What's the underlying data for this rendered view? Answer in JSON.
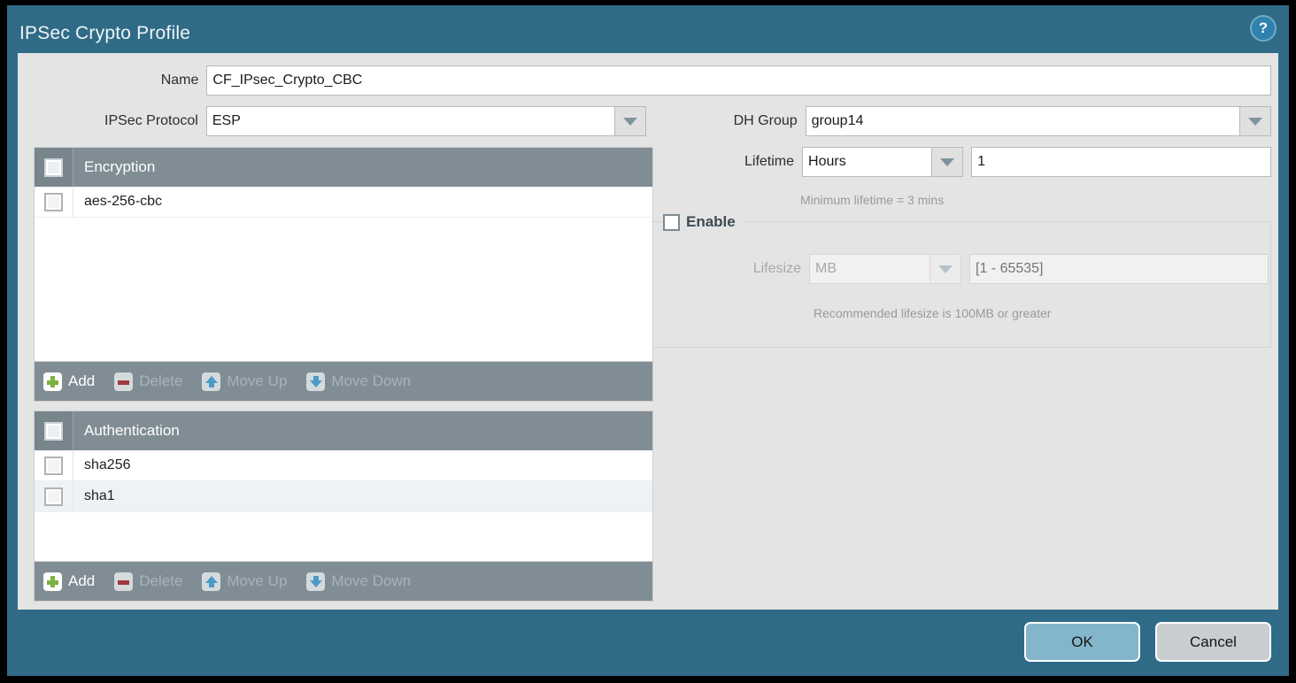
{
  "window": {
    "title": "IPSec Crypto Profile",
    "help_icon": "help-circle-icon",
    "help_glyph": "?"
  },
  "form": {
    "name": {
      "label": "Name",
      "value": "CF_IPsec_Crypto_CBC"
    },
    "ipsec_protocol": {
      "label": "IPSec Protocol",
      "value": "ESP"
    },
    "dh_group": {
      "label": "DH Group",
      "value": "group14"
    },
    "lifetime": {
      "label": "Lifetime",
      "unit": "Hours",
      "value": "1",
      "hint": "Minimum lifetime = 3 mins"
    },
    "lifesize": {
      "enable_label": "Enable",
      "label": "Lifesize",
      "unit": "MB",
      "value": "",
      "placeholder": "[1 - 65535]",
      "hint": "Recommended lifesize is 100MB or greater"
    }
  },
  "encryption_panel": {
    "header": "Encryption",
    "rows": [
      {
        "label": "aes-256-cbc"
      }
    ]
  },
  "authentication_panel": {
    "header": "Authentication",
    "rows": [
      {
        "label": "sha256"
      },
      {
        "label": "sha1"
      }
    ]
  },
  "toolbar": {
    "add": "Add",
    "delete": "Delete",
    "move_up": "Move Up",
    "move_down": "Move Down"
  },
  "footer": {
    "ok": "OK",
    "cancel": "Cancel"
  },
  "colors": {
    "title_bar": "#2f6b87",
    "body": "#e4e4e4",
    "list_header": "#808d95",
    "toolbar": "#808d95",
    "ok_button": "#83b6cb",
    "cancel_button": "#c9cdd0",
    "add_icon": "#7cb342",
    "delete_icon": "#9e3b3b",
    "move_icon": "#4a9cc4",
    "hint_text": "#9a9a9a"
  }
}
